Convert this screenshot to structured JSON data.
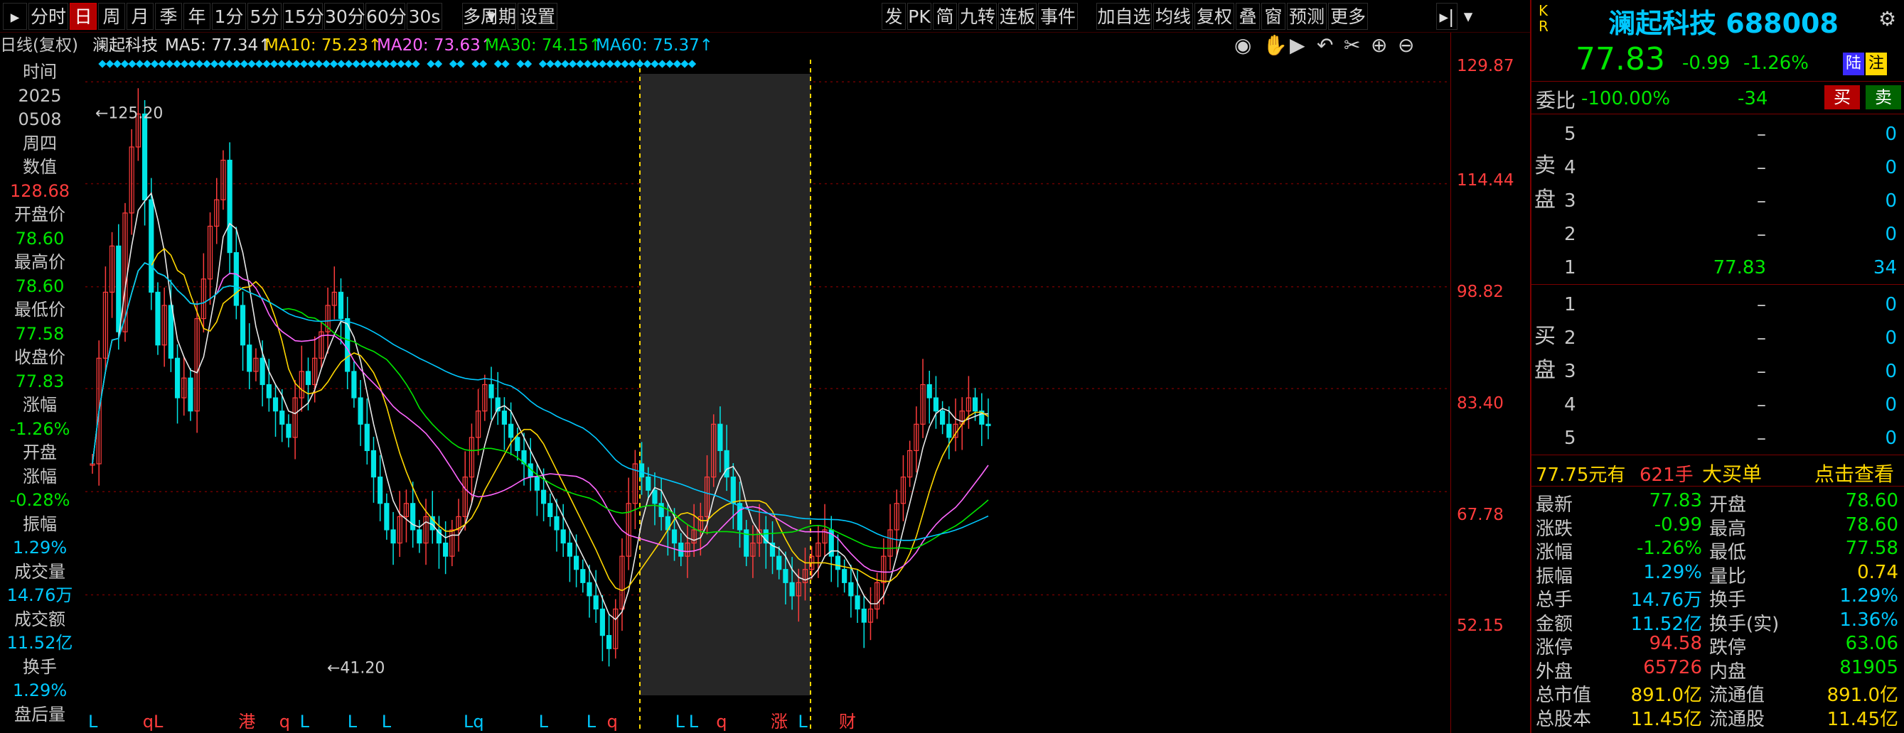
{
  "toolbar": {
    "left_items": [
      {
        "label": "分时",
        "active": false
      },
      {
        "label": "日",
        "active": true
      },
      {
        "label": "周",
        "active": false
      },
      {
        "label": "月",
        "active": false
      },
      {
        "label": "季",
        "active": false
      },
      {
        "label": "年",
        "active": false
      },
      {
        "label": "1分",
        "active": false
      },
      {
        "label": "5分",
        "active": false
      },
      {
        "label": "15分",
        "active": false
      },
      {
        "label": "30分",
        "active": false
      },
      {
        "label": "60分",
        "active": false
      },
      {
        "label": "30s",
        "active": false
      },
      {
        "label": "多周期",
        "active": false
      },
      {
        "label": "设置",
        "active": false
      }
    ],
    "right_items": [
      "发",
      "PK",
      "简",
      "九转",
      "连板",
      "事件",
      "加自选",
      "均线",
      "复权",
      "叠",
      "窗",
      "预测",
      "更多"
    ]
  },
  "info": {
    "period": "日线(复权)",
    "stock_name": "澜起科技",
    "ma5": "MA5: 77.34↑",
    "ma10": "MA10: 75.23↑",
    "ma20": "MA20: 73.63↑",
    "ma30": "MA30: 74.15↑",
    "ma60": "MA60: 75.37↑"
  },
  "datacol": [
    {
      "text": "时间",
      "color": "#c8c8c8"
    },
    {
      "text": "2025",
      "color": "#c8c8c8"
    },
    {
      "text": "0508",
      "color": "#c8c8c8"
    },
    {
      "text": "周四",
      "color": "#c8c8c8"
    },
    {
      "text": "数值",
      "color": "#c8c8c8"
    },
    {
      "text": "128.68",
      "color": "#ff3c3c"
    },
    {
      "text": "开盘价",
      "color": "#c8c8c8"
    },
    {
      "text": "78.60",
      "color": "#00e600"
    },
    {
      "text": "最高价",
      "color": "#c8c8c8"
    },
    {
      "text": "78.60",
      "color": "#00e600"
    },
    {
      "text": "最低价",
      "color": "#c8c8c8"
    },
    {
      "text": "77.58",
      "color": "#00e600"
    },
    {
      "text": "收盘价",
      "color": "#c8c8c8"
    },
    {
      "text": "77.83",
      "color": "#00e600"
    },
    {
      "text": "涨幅",
      "color": "#c8c8c8"
    },
    {
      "text": "-1.26%",
      "color": "#00e600"
    },
    {
      "text": "开盘",
      "color": "#c8c8c8"
    },
    {
      "text": "涨幅",
      "color": "#c8c8c8"
    },
    {
      "text": "-0.28%",
      "color": "#00e600"
    },
    {
      "text": "振幅",
      "color": "#c8c8c8"
    },
    {
      "text": "1.29%",
      "color": "#00c8ff"
    },
    {
      "text": "成交量",
      "color": "#c8c8c8"
    },
    {
      "text": "14.76万",
      "color": "#00c8ff"
    },
    {
      "text": "成交额",
      "color": "#c8c8c8"
    },
    {
      "text": "11.52亿",
      "color": "#00c8ff"
    },
    {
      "text": "换手",
      "color": "#c8c8c8"
    },
    {
      "text": "1.29%",
      "color": "#00c8ff"
    },
    {
      "text": "盘后量",
      "color": "#c8c8c8"
    }
  ],
  "chart_data": {
    "type": "candlestick",
    "y_ticks": [
      "129.87",
      "114.44",
      "98.82",
      "83.40",
      "67.78",
      "52.15"
    ],
    "ylim": [
      38,
      130
    ],
    "annotations": [
      "125.20",
      "41.20"
    ],
    "grid": true,
    "closes": [
      72,
      88,
      98,
      105,
      92,
      110,
      120,
      125,
      112,
      98,
      90,
      96,
      88,
      82,
      85,
      80,
      94,
      100,
      108,
      112,
      118,
      104,
      96,
      90,
      86,
      88,
      84,
      82,
      80,
      78,
      76,
      82,
      86,
      84,
      88,
      92,
      96,
      98,
      94,
      86,
      82,
      78,
      74,
      70,
      66,
      62,
      60,
      64,
      66,
      62,
      60,
      64,
      62,
      60,
      58,
      62,
      64,
      70,
      76,
      80,
      84,
      82,
      80,
      78,
      76,
      74,
      72,
      70,
      68,
      66,
      64,
      62,
      60,
      58,
      56,
      54,
      52,
      50,
      46,
      44,
      50,
      58,
      66,
      72,
      70,
      68,
      66,
      64,
      62,
      60,
      58,
      60,
      62,
      64,
      70,
      78,
      74,
      70,
      66,
      62,
      58,
      60,
      62,
      60,
      58,
      56,
      54,
      52,
      54,
      56,
      58,
      60,
      62,
      58,
      56,
      54,
      52,
      50,
      48,
      50,
      54,
      58,
      62,
      66,
      70,
      74,
      78,
      84,
      82,
      80,
      78,
      76,
      78,
      80,
      82,
      80,
      78,
      77.83
    ],
    "events": [
      {
        "label": "L",
        "color": "#00c8ff",
        "x": 0.0
      },
      {
        "label": "qL",
        "color": "#ff3c3c",
        "x": 0.04
      },
      {
        "label": "港",
        "color": "#ff3c3c",
        "x": 0.11
      },
      {
        "label": "q",
        "color": "#ff3c3c",
        "x": 0.14
      },
      {
        "label": "L",
        "color": "#00c8ff",
        "x": 0.155
      },
      {
        "label": "L",
        "color": "#00c8ff",
        "x": 0.19
      },
      {
        "label": "L",
        "color": "#00c8ff",
        "x": 0.215
      },
      {
        "label": "Lq",
        "color": "#00c8ff",
        "x": 0.275
      },
      {
        "label": "L",
        "color": "#00c8ff",
        "x": 0.33
      },
      {
        "label": "L",
        "color": "#00c8ff",
        "x": 0.365
      },
      {
        "label": "q",
        "color": "#ff3c3c",
        "x": 0.38
      },
      {
        "label": "L",
        "color": "#00c8ff",
        "x": 0.43
      },
      {
        "label": "L",
        "color": "#00c8ff",
        "x": 0.44
      },
      {
        "label": "q",
        "color": "#ff3c3c",
        "x": 0.46
      },
      {
        "label": "涨",
        "color": "#ff3c3c",
        "x": 0.5
      },
      {
        "label": "L",
        "color": "#00c8ff",
        "x": 0.52
      },
      {
        "label": "财",
        "color": "#ff3c3c",
        "x": 0.55
      }
    ]
  },
  "right": {
    "kr": "K\nR",
    "stock_title": "澜起科技 688008",
    "price": "77.83",
    "change": "-0.99",
    "change_pct": "-1.26%",
    "tag_lu": "陆",
    "tag_zhu": "注",
    "weibi_label": "委比",
    "weibi_pct": "-100.00%",
    "weibi_diff": "-34",
    "btn_buy": "买",
    "btn_sell": "卖",
    "sell_label": "卖盘",
    "buy_label": "买盘",
    "sell_rows": [
      {
        "n": "5",
        "p": "–",
        "v": "0"
      },
      {
        "n": "4",
        "p": "–",
        "v": "0"
      },
      {
        "n": "3",
        "p": "–",
        "v": "0"
      },
      {
        "n": "2",
        "p": "–",
        "v": "0"
      },
      {
        "n": "1",
        "p": "77.83",
        "v": "34"
      }
    ],
    "buy_rows": [
      {
        "n": "1",
        "p": "–",
        "v": "0"
      },
      {
        "n": "2",
        "p": "–",
        "v": "0"
      },
      {
        "n": "3",
        "p": "–",
        "v": "0"
      },
      {
        "n": "4",
        "p": "–",
        "v": "0"
      },
      {
        "n": "5",
        "p": "–",
        "v": "0"
      }
    ],
    "bigorder_price": "77.75元有",
    "bigorder_qty": "621手",
    "bigorder_label": "大买单",
    "bigorder_link": "点击查看",
    "stats": [
      {
        "l1": "最新",
        "v1": "77.83",
        "c1": "#00e600",
        "l2": "开盘",
        "v2": "78.60",
        "c2": "#00e600"
      },
      {
        "l1": "涨跌",
        "v1": "-0.99",
        "c1": "#00e600",
        "l2": "最高",
        "v2": "78.60",
        "c2": "#00e600"
      },
      {
        "l1": "涨幅",
        "v1": "-1.26%",
        "c1": "#00e600",
        "l2": "最低",
        "v2": "77.58",
        "c2": "#00e600"
      },
      {
        "l1": "振幅",
        "v1": "1.29%",
        "c1": "#00c8ff",
        "l2": "量比",
        "v2": "0.74",
        "c2": "#ffd700"
      },
      {
        "l1": "总手",
        "v1": "14.76万",
        "c1": "#00c8ff",
        "l2": "换手",
        "v2": "1.29%",
        "c2": "#00c8ff"
      },
      {
        "l1": "金额",
        "v1": "11.52亿",
        "c1": "#00c8ff",
        "l2": "换手(实)",
        "v2": "1.36%",
        "c2": "#00c8ff"
      },
      {
        "l1": "涨停",
        "v1": "94.58",
        "c1": "#ff3c3c",
        "l2": "跌停",
        "v2": "63.06",
        "c2": "#00e600"
      },
      {
        "l1": "外盘",
        "v1": "65726",
        "c1": "#ff3c3c",
        "l2": "内盘",
        "v2": "81905",
        "c2": "#00e600"
      },
      {
        "l1": "总市值",
        "v1": "891.0亿",
        "c1": "#ffd700",
        "l2": "流通值",
        "v2": "891.0亿",
        "c2": "#ffd700"
      },
      {
        "l1": "总股本",
        "v1": "11.45亿",
        "c1": "#ffd700",
        "l2": "流通股",
        "v2": "11.45亿",
        "c2": "#ffd700"
      }
    ]
  }
}
